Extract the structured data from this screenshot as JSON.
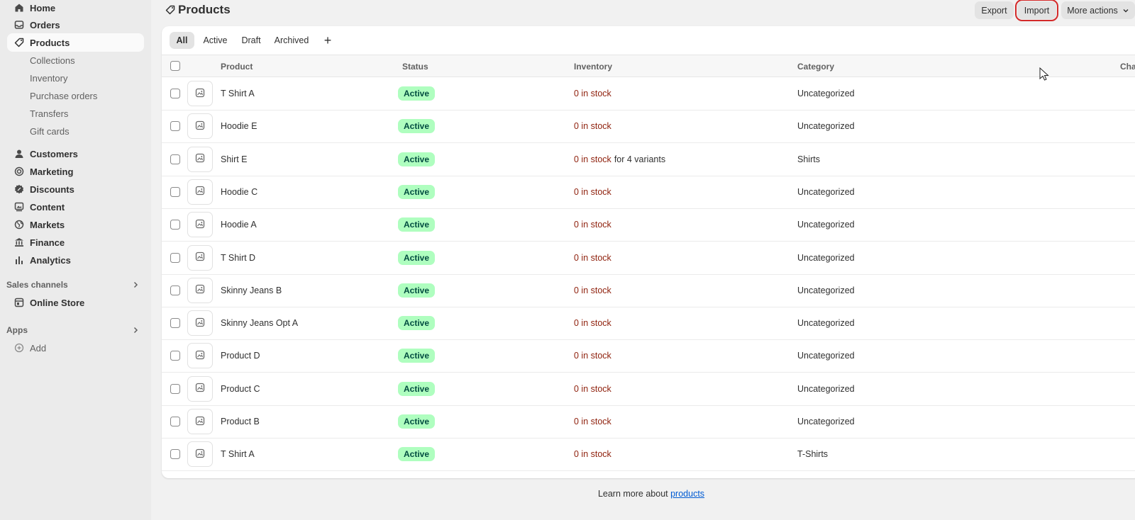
{
  "sidebar": {
    "items": [
      {
        "label": "Home",
        "icon": "home-icon"
      },
      {
        "label": "Orders",
        "icon": "inbox-icon"
      },
      {
        "label": "Products",
        "icon": "tag-icon"
      }
    ],
    "sub_items": [
      "Collections",
      "Inventory",
      "Purchase orders",
      "Transfers",
      "Gift cards"
    ],
    "items2": [
      {
        "label": "Customers",
        "icon": "person-icon"
      },
      {
        "label": "Marketing",
        "icon": "target-icon"
      },
      {
        "label": "Discounts",
        "icon": "discount-icon"
      },
      {
        "label": "Content",
        "icon": "content-icon"
      },
      {
        "label": "Markets",
        "icon": "globe-icon"
      },
      {
        "label": "Finance",
        "icon": "bank-icon"
      },
      {
        "label": "Analytics",
        "icon": "bar-chart-icon"
      }
    ],
    "sales_channels": {
      "title": "Sales channels",
      "online_store": "Online Store"
    },
    "apps": {
      "title": "Apps",
      "add": "Add"
    }
  },
  "header": {
    "title": "Products",
    "export_label": "Export",
    "import_label": "Import",
    "more_actions_label": "More actions"
  },
  "tabs": [
    "All",
    "Active",
    "Draft",
    "Archived",
    "+"
  ],
  "table": {
    "columns": [
      "Product",
      "Status",
      "Inventory",
      "Category",
      "Cha"
    ],
    "rows": [
      {
        "product": "T Shirt A",
        "status": "Active",
        "stock": "0 in stock",
        "variants": "",
        "category": "Uncategorized"
      },
      {
        "product": "Hoodie E",
        "status": "Active",
        "stock": "0 in stock",
        "variants": "",
        "category": "Uncategorized"
      },
      {
        "product": "Shirt E",
        "status": "Active",
        "stock": "0 in stock",
        "variants": "for 4 variants",
        "category": "Shirts"
      },
      {
        "product": "Hoodie C",
        "status": "Active",
        "stock": "0 in stock",
        "variants": "",
        "category": "Uncategorized"
      },
      {
        "product": "Hoodie A",
        "status": "Active",
        "stock": "0 in stock",
        "variants": "",
        "category": "Uncategorized"
      },
      {
        "product": "T Shirt D",
        "status": "Active",
        "stock": "0 in stock",
        "variants": "",
        "category": "Uncategorized"
      },
      {
        "product": "Skinny Jeans B",
        "status": "Active",
        "stock": "0 in stock",
        "variants": "",
        "category": "Uncategorized"
      },
      {
        "product": "Skinny Jeans Opt A",
        "status": "Active",
        "stock": "0 in stock",
        "variants": "",
        "category": "Uncategorized"
      },
      {
        "product": "Product D",
        "status": "Active",
        "stock": "0 in stock",
        "variants": "",
        "category": "Uncategorized"
      },
      {
        "product": "Product C",
        "status": "Active",
        "stock": "0 in stock",
        "variants": "",
        "category": "Uncategorized"
      },
      {
        "product": "Product B",
        "status": "Active",
        "stock": "0 in stock",
        "variants": "",
        "category": "Uncategorized"
      },
      {
        "product": "T Shirt A",
        "status": "Active",
        "stock": "0 in stock",
        "variants": "",
        "category": "T-Shirts"
      }
    ]
  },
  "footer": {
    "text": "Learn more about",
    "link": "products"
  },
  "colors": {
    "accent_link": "#005bd3",
    "badge_bg": "#affebf",
    "badge_text": "#014b40",
    "stock_red": "#8e1f0b",
    "highlight": "#d42a2a"
  }
}
